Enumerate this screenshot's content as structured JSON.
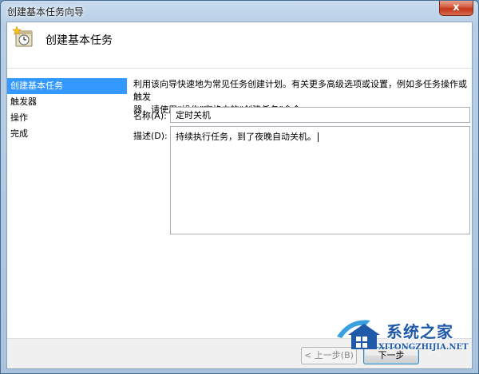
{
  "window": {
    "title": "创建基本任务向导",
    "close_label": "x"
  },
  "header": {
    "title": "创建基本任务"
  },
  "steps": [
    {
      "label": "创建基本任务"
    },
    {
      "label": "触发器"
    },
    {
      "label": "操作"
    },
    {
      "label": "完成"
    }
  ],
  "content": {
    "intro_line1": "利用该向导快速地为常见任务创建计划。有关更多高级选项或设置，例如多任务操作或触发",
    "intro_line2": "器，请使用“操作”窗格中的“创建任务”命令。",
    "name_label": "名称(A):",
    "name_value": "定时关机",
    "desc_label": "描述(D):",
    "desc_value": "持续执行任务，到了夜晚自动关机。"
  },
  "footer": {
    "back_label": "< 上一步(B)",
    "next_label": "下一步"
  },
  "watermark": {
    "cn": "系统之家",
    "en": "XITONGZHIJIA.NET"
  },
  "colors": {
    "selection": "#3399ff",
    "watermark": "#1e5aa8"
  }
}
